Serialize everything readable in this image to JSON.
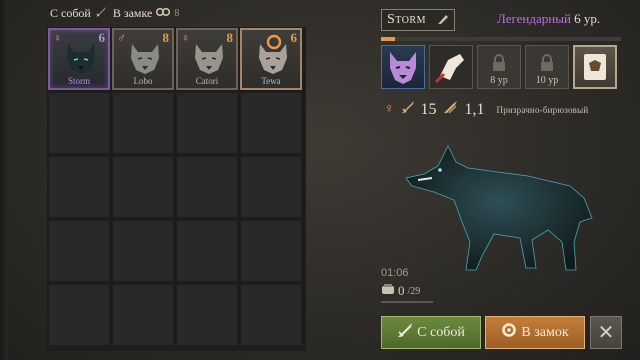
{
  "tabs": {
    "with_me_label": "С собой",
    "in_castle_label": "В замке",
    "count_label": "8"
  },
  "slots": [
    {
      "name": "Storm",
      "level": "6",
      "sex": "♀"
    },
    {
      "name": "Lobo",
      "level": "8",
      "sex": "♂"
    },
    {
      "name": "Catori",
      "level": "8",
      "sex": "♀"
    },
    {
      "name": "Tewa",
      "level": "6",
      "sex": ""
    }
  ],
  "pet": {
    "name": "Storm",
    "rarity": "Легендарный",
    "level_label": "6 ур.",
    "xp_percent": 6,
    "sex": "♀",
    "attack": "15",
    "speed": "1,1",
    "color_name": "Призрачно-бирюзовый",
    "timer": "01:06",
    "food_current": "0",
    "food_max": "/29"
  },
  "skills": [
    {
      "state": "unlocked"
    },
    {
      "state": "unlocked"
    },
    {
      "state": "locked",
      "req": "8 ур"
    },
    {
      "state": "locked",
      "req": "10 ур"
    },
    {
      "state": "active"
    }
  ],
  "buttons": {
    "take_label": "С собой",
    "castle_label": "В замок",
    "close_label": "✕"
  },
  "icons": {
    "take": "sword-icon",
    "castle": "gear-icon",
    "close": "close-icon"
  },
  "colors": {
    "legendary": "#c06ee0",
    "level": "#e89a4a",
    "take_button": "#5f7d34",
    "castle_button": "#b5712f"
  }
}
